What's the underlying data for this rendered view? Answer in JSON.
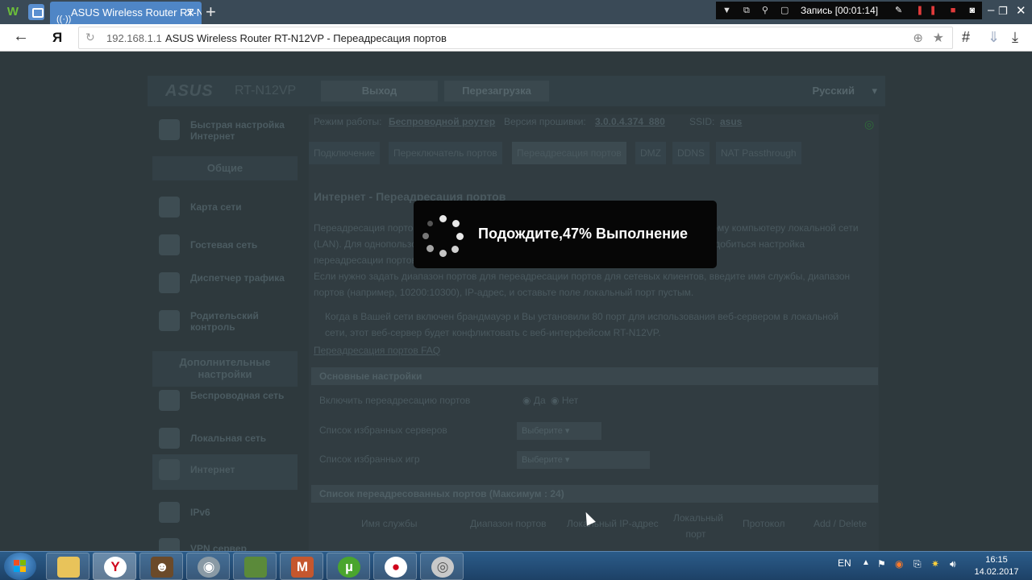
{
  "browser": {
    "tab_title": "ASUS Wireless Router RT-N12VP",
    "tab_close": "✕",
    "new_tab": "+",
    "logo_letter": "W",
    "url_host": "192.168.1.1",
    "url_title": "ASUS Wireless Router RT-N12VP - Переадресация портов",
    "yandex_logo": "Я"
  },
  "recorder": {
    "label": "Запись [00:01:14]"
  },
  "router": {
    "logo": "ASUS",
    "model": "RT-N12VP",
    "header_buttons": [
      "Выход",
      "Перезагрузка"
    ],
    "language": "Русский",
    "mode_label": "Режим работы:",
    "mode_value": "Беспроводной роутер",
    "firmware_label": "Версия прошивки:",
    "firmware_value": "3.0.0.4.374_880",
    "ssid_label": "SSID:",
    "ssid_value": "asus",
    "quick_setup": "Быстрая настройка Интернет",
    "section_general": "Общие",
    "sidebar_general": [
      "Карта сети",
      "Гостевая сеть",
      "Диспетчер трафика",
      "Родительский контроль"
    ],
    "section_advanced": "Дополнительные настройки",
    "sidebar_advanced": [
      "Беспроводная сеть",
      "Локальная сеть",
      "Интернет",
      "IPv6",
      "VPN сервер"
    ],
    "tabs": [
      "Подключение",
      "Переключатель портов",
      "Переадресация портов",
      "DMZ",
      "DDNS",
      "NAT Passthrough"
    ],
    "page_title": "Интернет - Переадресация портов",
    "desc_lines": [
      "Переадресация портов позволяет удаленным компьютерам подключаться к определенному компьютеру локальной сети",
      "(LAN). Для однопользовательских игр, сетевых приложений (например, P2P) может понадобиться настройка",
      "переадресации портов. Подробную информацию смотрите в руководстве пользователя.",
      "Если нужно задать диапазон портов для переадресации портов для сетевых клиентов, введите имя службы, диапазон",
      "портов (например, 10200:10300), IP-адрес, и оставьте поле локальный порт пустым."
    ],
    "note_lines": [
      "Когда в Вашей сети включен брандмауэр и Вы установили 80 порт для использования веб-сервером в локальной",
      "сети, этот веб-сервер будет конфликтовать с веб-интерфейсом RT-N12VP."
    ],
    "faq_link": "Переадресация портов FAQ",
    "basic_settings": "Основные настройки",
    "enable_label": "Включить переадресацию портов",
    "yes": "Да",
    "no": "Нет",
    "server_list_label": "Список избранных серверов",
    "server_select": "Выберите",
    "games_list_label": "Список избранных игр",
    "games_select": "Выберите",
    "list_header": "Список переадресованных портов (Максимум : 24)",
    "columns": [
      "Имя службы",
      "Диапазон портов",
      "Локальный IP-адрес",
      "Локальный порт",
      "Протокол",
      "Add / Delete"
    ]
  },
  "modal": {
    "message": "Подождите,47% Выполнение",
    "progress_percent": 47
  },
  "taskbar": {
    "lang": "EN",
    "time": "16:15",
    "date": "14.02.2017"
  }
}
